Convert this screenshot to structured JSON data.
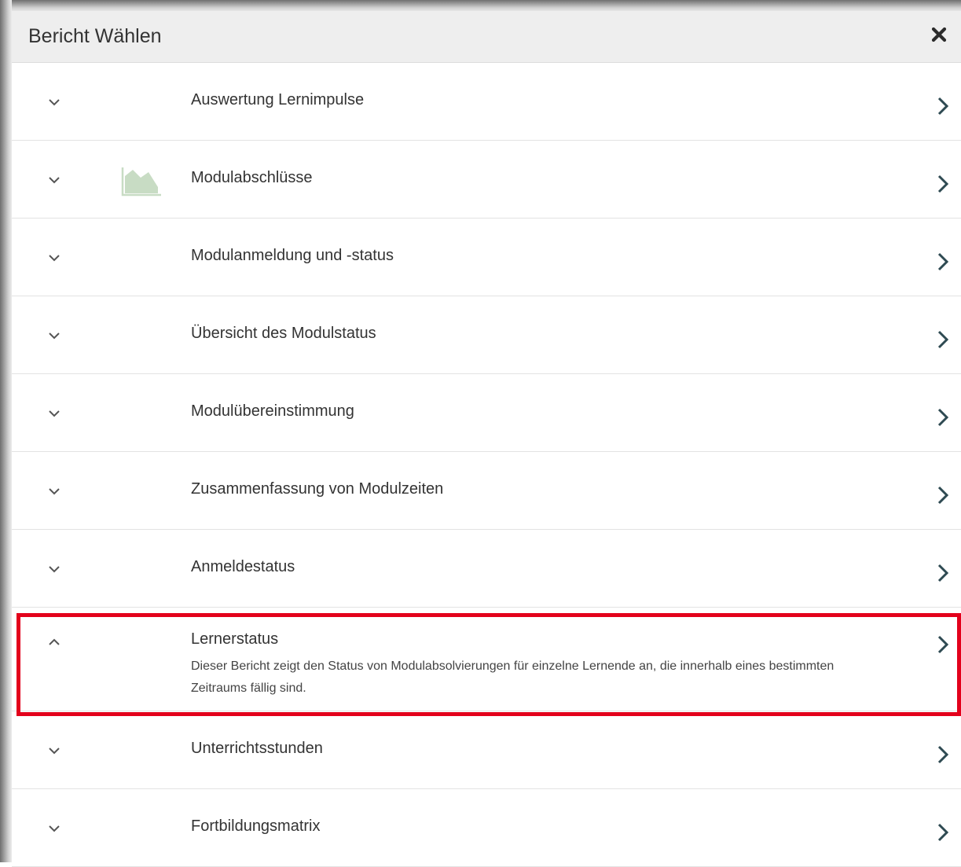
{
  "dialog": {
    "title": "Bericht Wählen",
    "close_icon": "close-icon"
  },
  "reports": [
    {
      "label": "Auswertung Lernimpulse",
      "expanded": false
    },
    {
      "label": "Modulabschlüsse",
      "expanded": false,
      "icon": "area-chart-icon"
    },
    {
      "label": "Modulanmeldung und -status",
      "expanded": false
    },
    {
      "label": "Übersicht des Modulstatus",
      "expanded": false
    },
    {
      "label": "Modulübereinstimmung",
      "expanded": false
    },
    {
      "label": "Zusammenfassung von Modulzeiten",
      "expanded": false
    },
    {
      "label": "Anmeldestatus",
      "expanded": false
    },
    {
      "label": "Lernerstatus",
      "expanded": true,
      "description": "Dieser Bericht zeigt den Status von Modulabsolvierungen für einzelne Lernende an, die innerhalb eines bestimmten Zeitraums fällig sind."
    },
    {
      "label": "Unterrichtsstunden",
      "expanded": false
    },
    {
      "label": "Fortbildungsmatrix",
      "expanded": false
    }
  ],
  "colors": {
    "header_bg": "#eeeeee",
    "arrow": "#2e4a52",
    "highlight": "#e3001b",
    "chart_icon": "#c8dcc4"
  }
}
